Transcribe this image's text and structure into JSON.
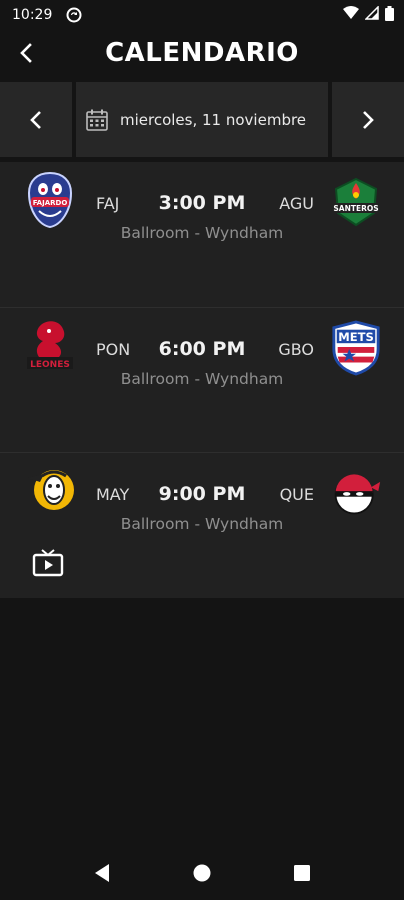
{
  "status_bar": {
    "time": "10:29"
  },
  "app_bar": {
    "title": "CALENDARIO"
  },
  "date_bar": {
    "date": "miercoles, 11 noviembre"
  },
  "games": [
    {
      "home": "FAJ",
      "away": "AGU",
      "time": "3:00 PM",
      "venue": "Ballroom - Wyndham",
      "home_logo_text": "FAJARDO",
      "away_logo_text": "SANTEROS"
    },
    {
      "home": "PON",
      "away": "GBO",
      "time": "6:00 PM",
      "venue": "Ballroom - Wyndham",
      "home_logo_text": "LEONES",
      "away_logo_text": "METS"
    },
    {
      "home": "MAY",
      "away": "QUE",
      "time": "9:00 PM",
      "venue": "Ballroom - Wyndham",
      "has_tv": true
    }
  ],
  "colors": {
    "background": "#141414",
    "card": "#212121",
    "nav_button": "#272727",
    "venue_text": "#8f8f8f"
  }
}
